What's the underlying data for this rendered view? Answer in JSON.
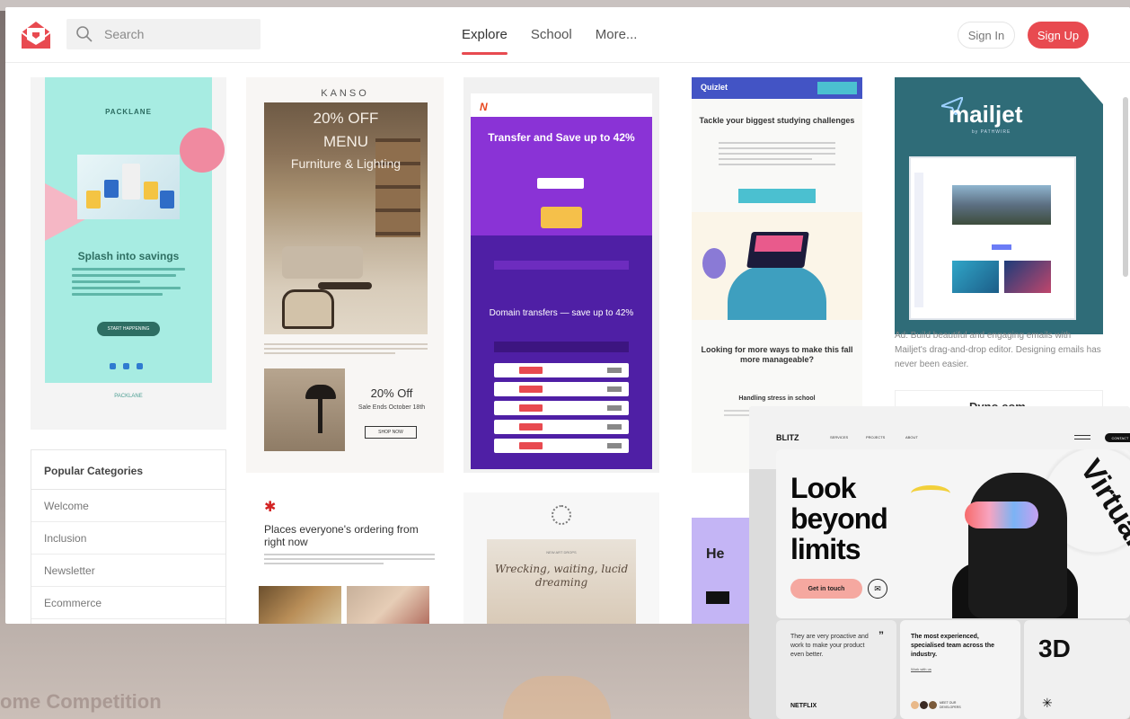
{
  "nav": {
    "search_placeholder": "Search",
    "tabs": [
      "Explore",
      "School",
      "More..."
    ],
    "sign_in": "Sign In",
    "sign_up": "Sign Up"
  },
  "colors": {
    "accent": "#e84a50"
  },
  "cards": {
    "packlane": {
      "brand": "PACKLANE",
      "title": "Splash into savings",
      "cta": "START HAPPENING",
      "footer": "PACKLANE"
    },
    "kanso": {
      "brand": "KANSO",
      "offer": "20% OFF",
      "menu": "MENU",
      "category": "Furniture & Lighting",
      "offer2": "20% Off",
      "sale": "Sale Ends October 18th",
      "shop": "SHOP NOW"
    },
    "namecheap": {
      "headline": "Transfer and Save up to 42%",
      "domain": "Domain transfers — save up to 42%"
    },
    "quizlet": {
      "logo": "Quizlet",
      "headline": "Tackle your biggest studying challenges",
      "subhead": "Looking for more ways to make this fall more manageable?",
      "section": "Handling stress in school"
    },
    "mailjet": {
      "logo": "mailjet",
      "by": "by PATHWIRE",
      "ad": "Ad: Build beautiful and engaging emails with Mailjet's drag-and-drop editor. Designing emails has never been easier."
    },
    "dyno": "Dyno.com",
    "yelp": {
      "title": "Places everyone's ordering from right now"
    },
    "art": {
      "title": "Wrecking, waiting, lucid dreaming",
      "tag": "NEW ART DROPS"
    },
    "purple": {
      "title": "He"
    }
  },
  "categories": {
    "header": "Popular Categories",
    "items": [
      "Welcome",
      "Inclusion",
      "Newsletter",
      "Ecommerce"
    ]
  },
  "blitz": {
    "logo": "BLITZ",
    "nav": [
      "SERVICES",
      "PROJECTS",
      "ABOUT"
    ],
    "contact": "CONTACT",
    "headline": "Look beyond limits",
    "cta": "Get in touch",
    "virtual": "Virtual",
    "card1": "They are very proactive and work to make your product even better.",
    "client": "NETFLIX",
    "card2": "The most experienced, specialised team across the industry.",
    "work": "Work with us",
    "meet": "MEET OUR DEVELOPERS",
    "card3": "3D"
  },
  "background_text": "ome Competition"
}
